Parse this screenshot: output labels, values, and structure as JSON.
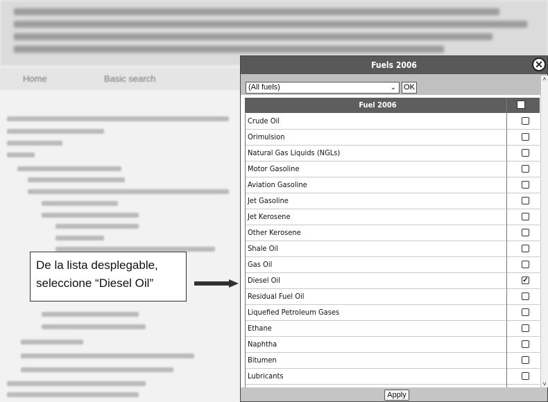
{
  "background": {
    "nav": {
      "home": "Home",
      "basic_search": "Basic search"
    }
  },
  "callout": {
    "line1": "De la lista desplegable,",
    "line2": "seleccione “Diesel Oil”"
  },
  "dialog": {
    "title": "Fuels 2006",
    "close_icon": "close-icon",
    "filter": {
      "selected": "(All fuels)",
      "ok_label": "OK"
    },
    "table": {
      "header": "Fuel 2006",
      "rows": [
        {
          "label": "Crude Oil",
          "checked": false
        },
        {
          "label": "Orimulsion",
          "checked": false
        },
        {
          "label": "Natural Gas Liquids (NGLs)",
          "checked": false
        },
        {
          "label": "Motor Gasoline",
          "checked": false
        },
        {
          "label": "Aviation Gasoline",
          "checked": false
        },
        {
          "label": "Jet Gasoline",
          "checked": false
        },
        {
          "label": "Jet Kerosene",
          "checked": false
        },
        {
          "label": "Other Kerosene",
          "checked": false
        },
        {
          "label": "Shale Oil",
          "checked": false
        },
        {
          "label": "Gas Oil",
          "checked": false
        },
        {
          "label": "Diesel Oil",
          "checked": true
        },
        {
          "label": "Residual Fuel Oil",
          "checked": false
        },
        {
          "label": "Liquefied Petroleum Gases",
          "checked": false
        },
        {
          "label": "Ethane",
          "checked": false
        },
        {
          "label": "Naphtha",
          "checked": false
        },
        {
          "label": "Bitumen",
          "checked": false
        },
        {
          "label": "Lubricants",
          "checked": false
        }
      ]
    },
    "apply_label": "Apply"
  }
}
